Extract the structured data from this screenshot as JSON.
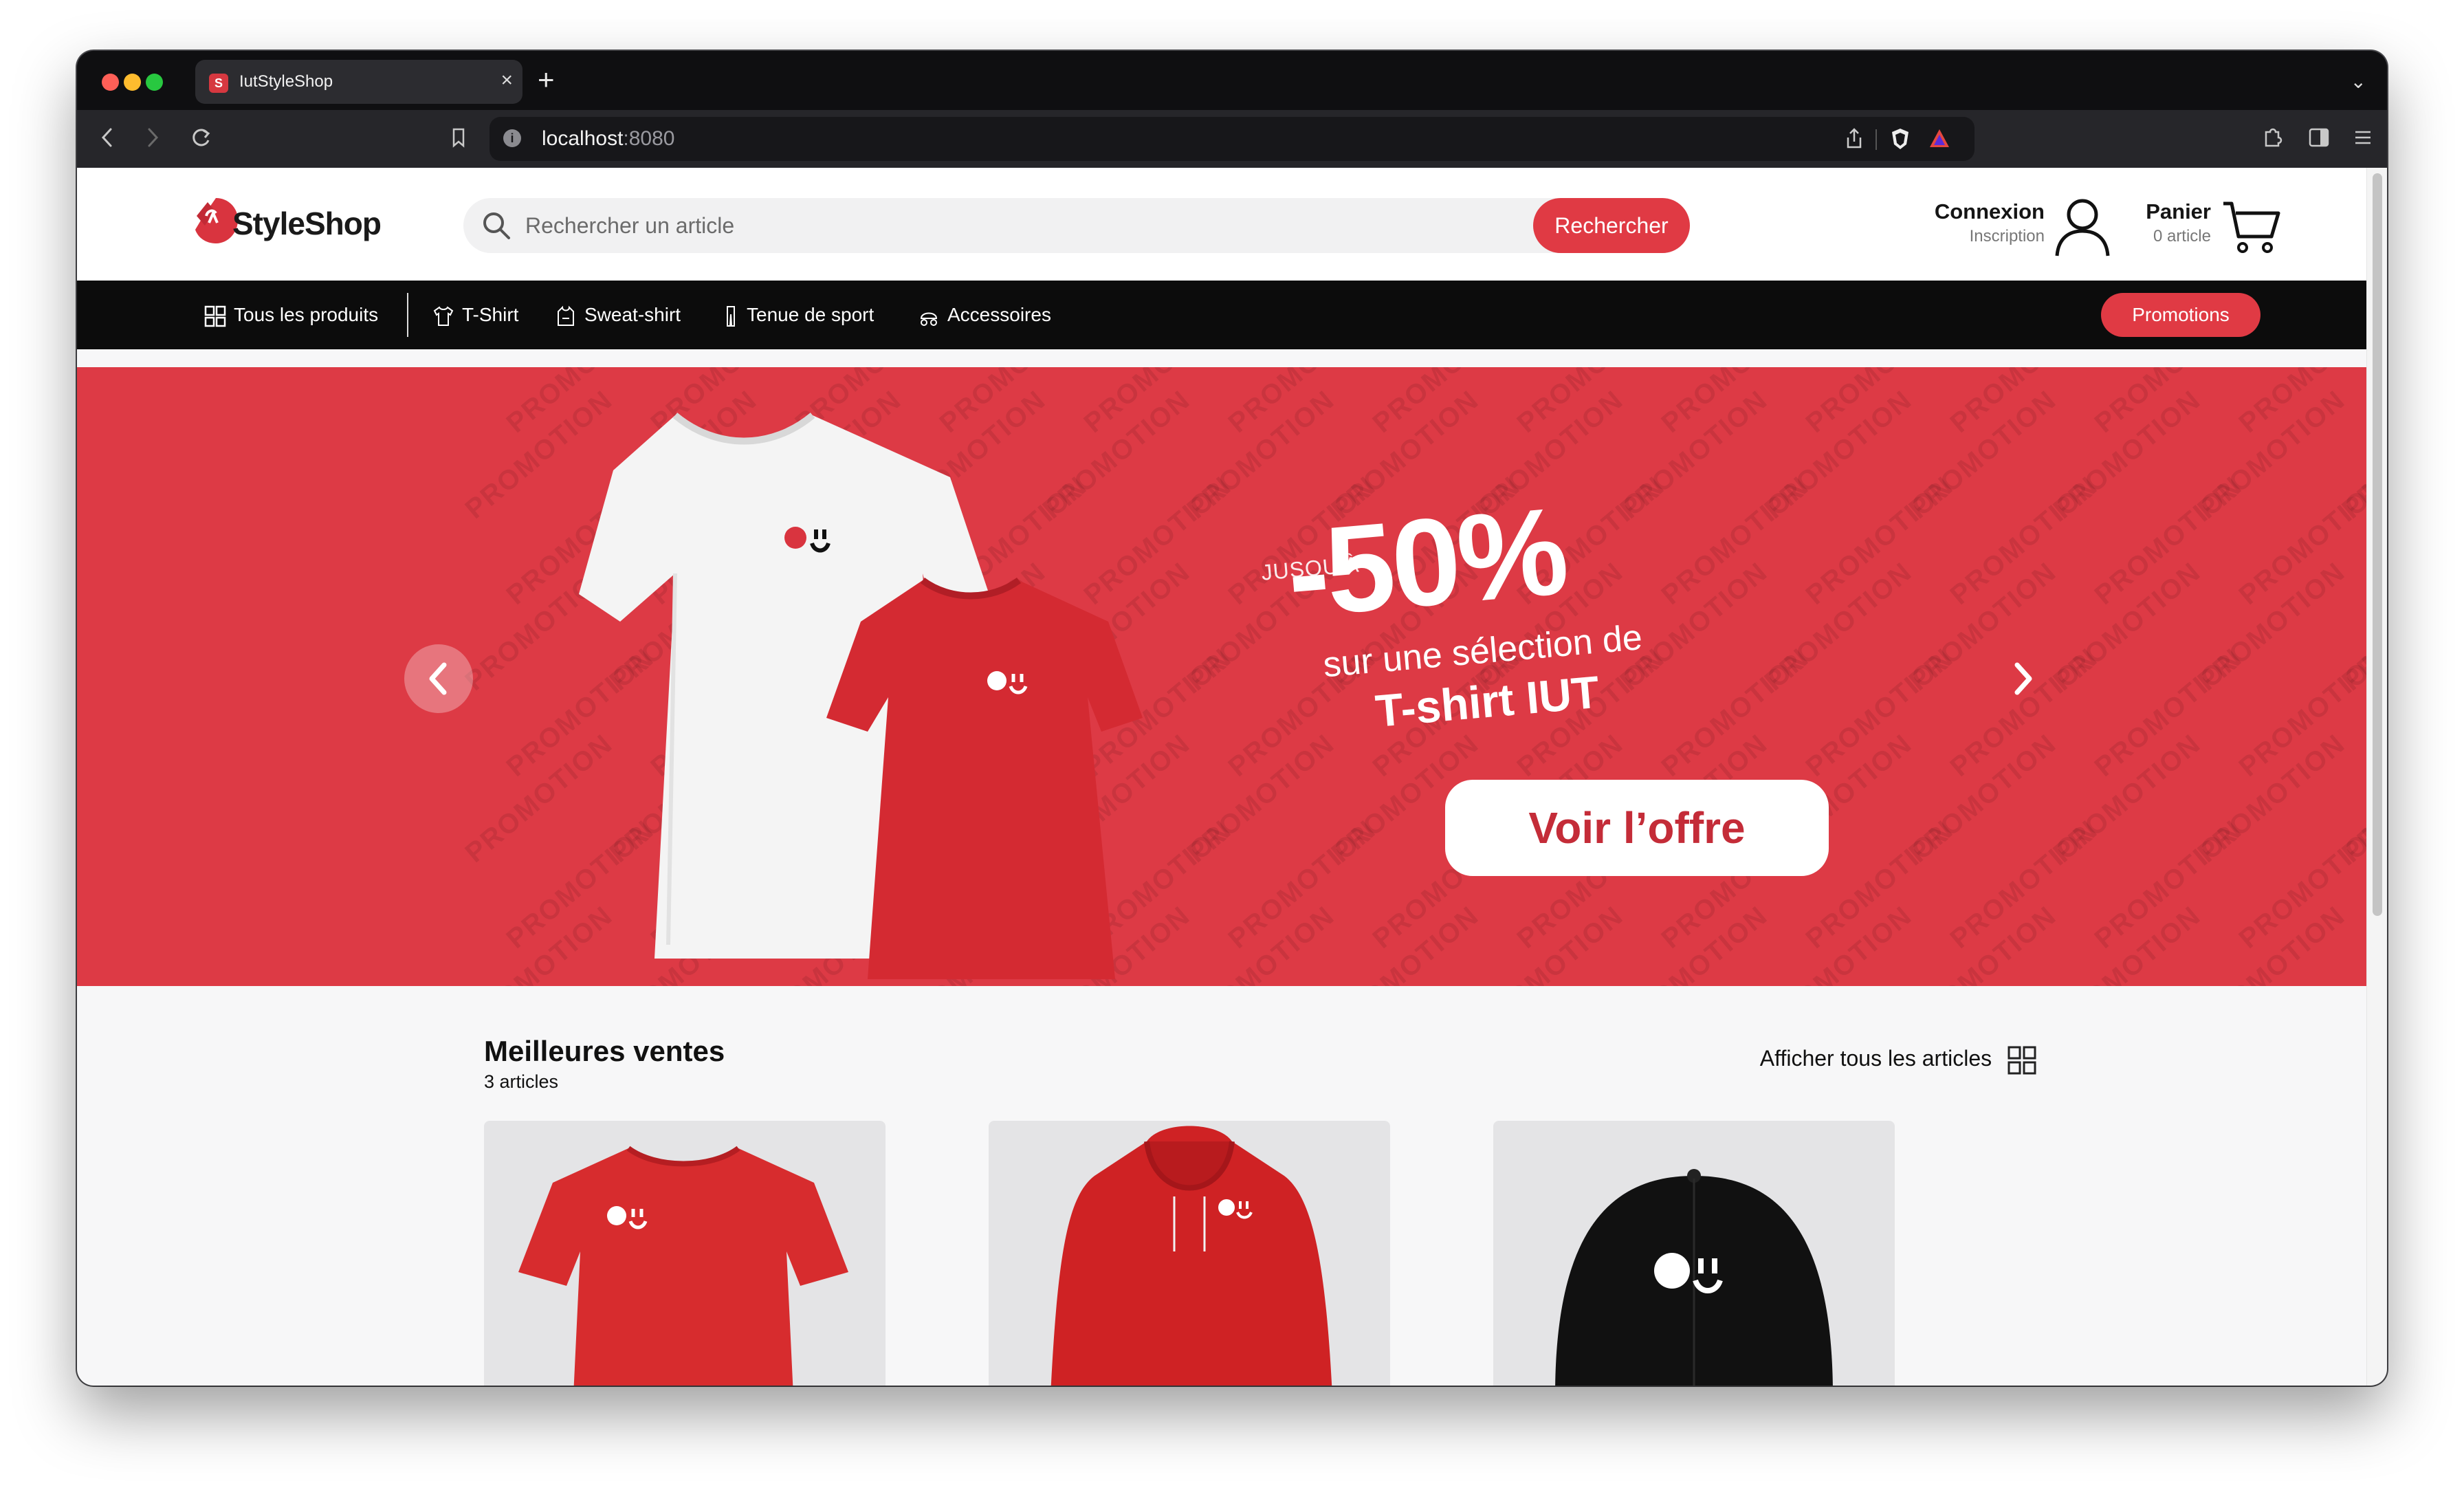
{
  "browser": {
    "tab_title": "IutStyleShop",
    "url_host": "localhost",
    "url_port": ":8080"
  },
  "site": {
    "brand": "StyleShop",
    "search": {
      "placeholder": "Rechercher un article",
      "button": "Rechercher"
    },
    "account": {
      "title": "Connexion",
      "subtitle": "Inscription"
    },
    "cart": {
      "title": "Panier",
      "count_label": "0 article"
    }
  },
  "nav": {
    "items": [
      {
        "label": "Tous les produits",
        "icon": "grid-icon"
      },
      {
        "label": "T-Shirt",
        "icon": "tshirt-icon"
      },
      {
        "label": "Sweat-shirt",
        "icon": "sweatshirt-icon"
      },
      {
        "label": "Tenue de sport",
        "icon": "sportswear-icon"
      },
      {
        "label": "Accessoires",
        "icon": "accessories-icon"
      }
    ],
    "promo_button": "Promotions"
  },
  "banner": {
    "prefix": "JUSQU'À",
    "discount": "-50%",
    "line1": "sur une sélection de",
    "line2": "T-shirt IUT",
    "cta": "Voir l’offre",
    "watermark": "PROMOTION",
    "bg_color": "#dd3a45"
  },
  "best_sellers": {
    "title": "Meilleures ventes",
    "count": "3 articles",
    "view_all": "Afficher tous les articles",
    "products": [
      {
        "kind": "tshirt",
        "color": "#d72c2e"
      },
      {
        "kind": "hoodie",
        "color": "#cf2224"
      },
      {
        "kind": "cap",
        "color": "#111111"
      }
    ]
  },
  "accent_color": "#e03a44"
}
